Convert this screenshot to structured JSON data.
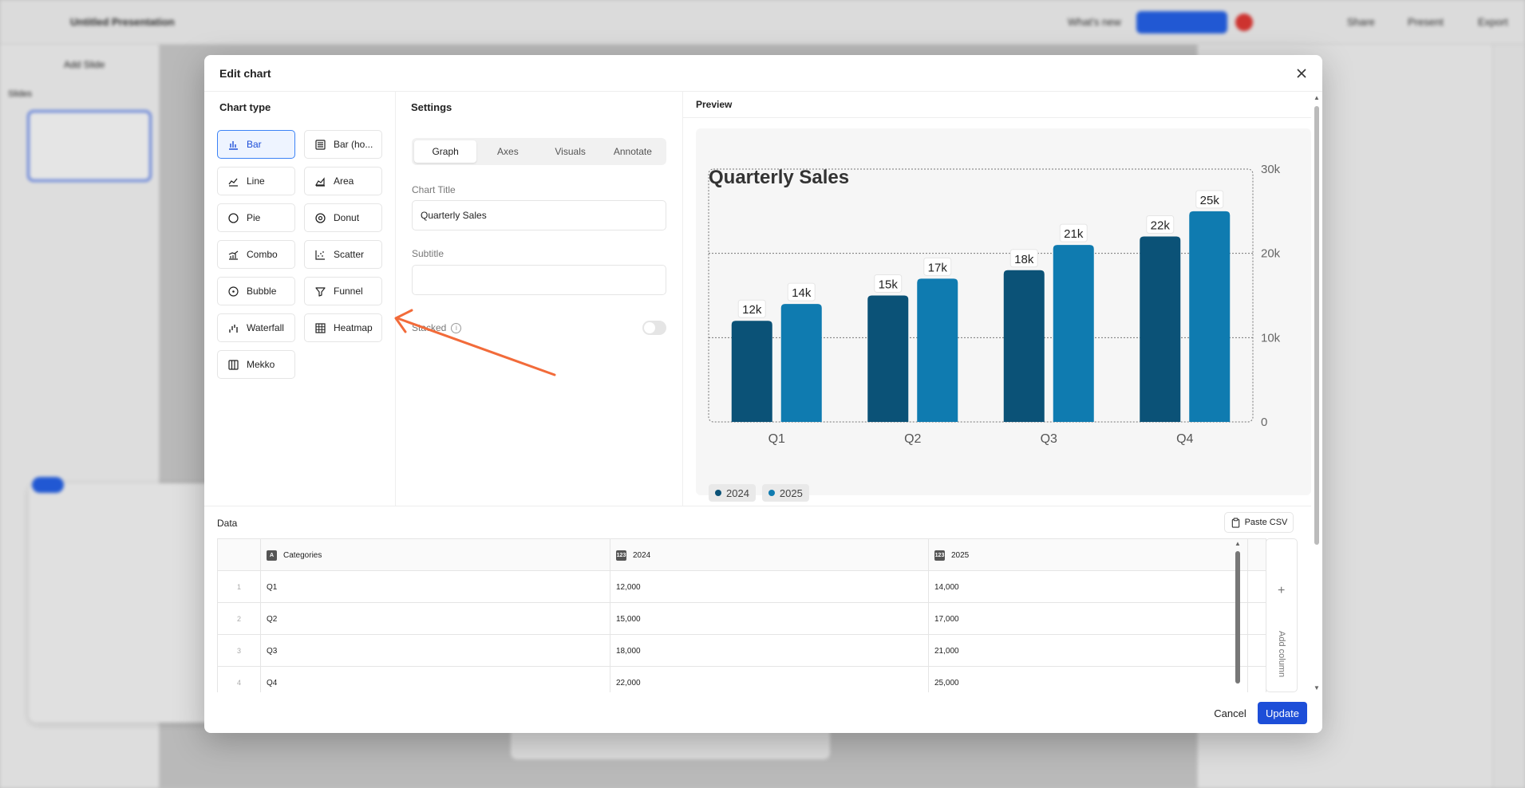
{
  "background": {
    "doc_title": "Untitled Presentation",
    "add_slide": "Add Slide",
    "slides_label": "Slides",
    "whats_new": "What's new",
    "upgrade": "Upgrade now",
    "share": "Share",
    "present": "Present",
    "export": "Export"
  },
  "modal": {
    "title": "Edit chart",
    "close_icon": "close-icon"
  },
  "chart_type": {
    "heading": "Chart type",
    "items": [
      {
        "label": "Bar",
        "icon": "bar-chart-icon",
        "active": true
      },
      {
        "label": "Bar (ho...",
        "icon": "bar-horizontal-icon",
        "active": false
      },
      {
        "label": "Line",
        "icon": "line-chart-icon",
        "active": false
      },
      {
        "label": "Area",
        "icon": "area-chart-icon",
        "active": false
      },
      {
        "label": "Pie",
        "icon": "pie-chart-icon",
        "active": false
      },
      {
        "label": "Donut",
        "icon": "donut-chart-icon",
        "active": false
      },
      {
        "label": "Combo",
        "icon": "combo-chart-icon",
        "active": false
      },
      {
        "label": "Scatter",
        "icon": "scatter-chart-icon",
        "active": false
      },
      {
        "label": "Bubble",
        "icon": "bubble-chart-icon",
        "active": false
      },
      {
        "label": "Funnel",
        "icon": "funnel-chart-icon",
        "active": false
      },
      {
        "label": "Waterfall",
        "icon": "waterfall-chart-icon",
        "active": false
      },
      {
        "label": "Heatmap",
        "icon": "heatmap-chart-icon",
        "active": false
      },
      {
        "label": "Mekko",
        "icon": "mekko-chart-icon",
        "active": false
      }
    ]
  },
  "settings": {
    "heading": "Settings",
    "tabs": [
      "Graph",
      "Axes",
      "Visuals",
      "Annotate"
    ],
    "active_tab": "Graph",
    "chart_title_label": "Chart Title",
    "chart_title_value": "Quarterly Sales",
    "subtitle_label": "Subtitle",
    "subtitle_value": "",
    "stacked_label": "Stacked",
    "stacked_on": false
  },
  "preview": {
    "heading": "Preview",
    "legend": [
      "2024",
      "2025"
    ]
  },
  "chart_data": {
    "type": "bar",
    "title": "Quarterly Sales",
    "categories": [
      "Q1",
      "Q2",
      "Q3",
      "Q4"
    ],
    "series": [
      {
        "name": "2024",
        "values": [
          12000,
          15000,
          18000,
          22000
        ],
        "labels": [
          "12k",
          "15k",
          "18k",
          "22k"
        ],
        "color": "#0b5277"
      },
      {
        "name": "2025",
        "values": [
          14000,
          17000,
          21000,
          25000
        ],
        "labels": [
          "14k",
          "17k",
          "21k",
          "25k"
        ],
        "color": "#0f7bb0"
      }
    ],
    "ylim": [
      0,
      30000
    ],
    "yticks": [
      "0",
      "10k",
      "20k",
      "30k"
    ],
    "ytick_values": [
      0,
      10000,
      20000,
      30000
    ],
    "grid": true,
    "legend_position": "bottom-left"
  },
  "data": {
    "heading": "Data",
    "paste_csv": "Paste CSV",
    "columns": [
      {
        "label": "Categories",
        "icon": "A"
      },
      {
        "label": "2024",
        "icon": "123"
      },
      {
        "label": "2025",
        "icon": "123"
      }
    ],
    "rows": [
      {
        "idx": "1",
        "cells": [
          "Q1",
          "12,000",
          "14,000"
        ]
      },
      {
        "idx": "2",
        "cells": [
          "Q2",
          "15,000",
          "17,000"
        ]
      },
      {
        "idx": "3",
        "cells": [
          "Q3",
          "18,000",
          "21,000"
        ]
      },
      {
        "idx": "4",
        "cells": [
          "Q4",
          "22,000",
          "25,000"
        ]
      }
    ],
    "add_column": "Add column"
  },
  "footer": {
    "cancel": "Cancel",
    "update": "Update"
  },
  "colors": {
    "accent": "#1d4ed8",
    "series_2024": "#0b5277",
    "series_2025": "#0f7bb0",
    "annotation_arrow": "#f26b3a"
  }
}
